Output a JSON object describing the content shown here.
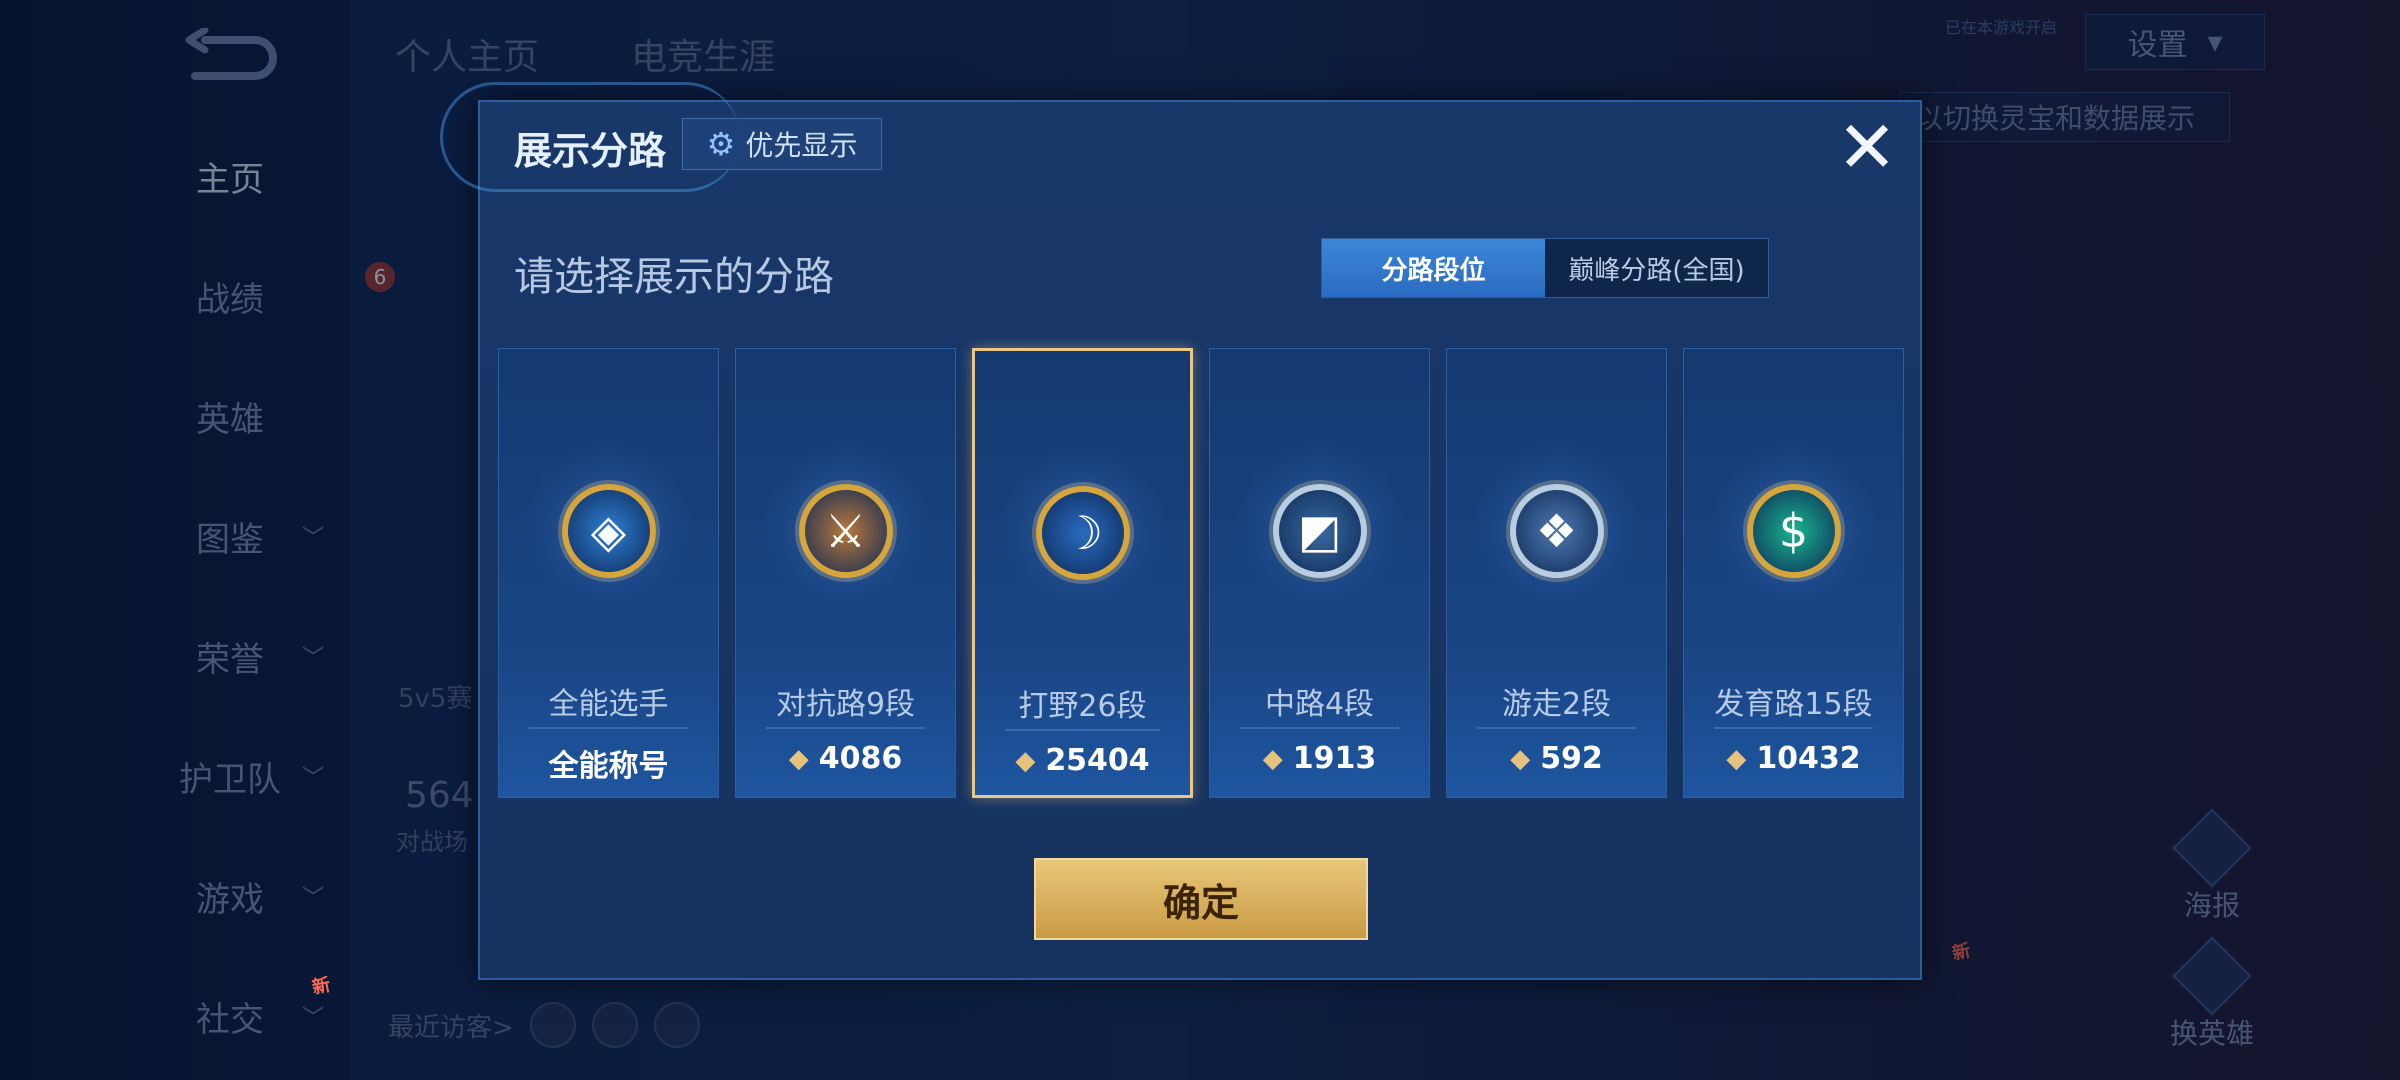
{
  "sidebar": {
    "items": [
      {
        "label": "主页",
        "has_chevron": false
      },
      {
        "label": "战绩",
        "has_chevron": false
      },
      {
        "label": "英雄",
        "has_chevron": false
      },
      {
        "label": "图鉴",
        "has_chevron": true
      },
      {
        "label": "荣誉",
        "has_chevron": true
      },
      {
        "label": "护卫队",
        "has_chevron": true
      },
      {
        "label": "游戏",
        "has_chevron": true
      },
      {
        "label": "社交",
        "has_chevron": true
      }
    ],
    "new_badge": "新"
  },
  "top_tabs": [
    "个人主页",
    "电竞生涯"
  ],
  "settings": {
    "label": "设置",
    "small_badge": "已在本游戏开启"
  },
  "hint_strip": "以切换灵宝和数据展示",
  "background": {
    "level_badge": "6",
    "stat_text_1": "5v5赛",
    "stat_value": "564",
    "stat_text_2": "对战场",
    "visitors_label": "最近访客>"
  },
  "side_tools": [
    {
      "label": "海报",
      "icon": "poster-icon"
    },
    {
      "label": "换英雄",
      "icon": "swap-hero-icon",
      "badge": "新"
    }
  ],
  "dialog": {
    "title": "展示分路",
    "priority_label": "优先显示",
    "close_symbol": "✕",
    "subtitle": "请选择展示的分路",
    "tabs": [
      {
        "label": "分路段位",
        "active": true
      },
      {
        "label": "巅峰分路(全国)",
        "active": false
      }
    ],
    "lanes": [
      {
        "name": "全能选手",
        "score": "全能称号",
        "icon": "all-round-emblem",
        "symbol": "◈",
        "selected": false,
        "metal": "gold",
        "color": "#2f7fd4"
      },
      {
        "name": "对抗路9段",
        "score": "4086",
        "icon": "clash-lane-emblem",
        "symbol": "⚔",
        "selected": false,
        "metal": "gold",
        "color": "#b9783a"
      },
      {
        "name": "打野26段",
        "score": "25404",
        "icon": "jungle-emblem",
        "symbol": "☽",
        "selected": true,
        "metal": "gold",
        "color": "#2a6cc0"
      },
      {
        "name": "中路4段",
        "score": "1913",
        "icon": "mid-lane-emblem",
        "symbol": "◩",
        "selected": false,
        "metal": "silver",
        "color": "#3a6aa0"
      },
      {
        "name": "游走2段",
        "score": "592",
        "icon": "roam-emblem",
        "symbol": "❖",
        "selected": false,
        "metal": "silver",
        "color": "#4f7ab0"
      },
      {
        "name": "发育路15段",
        "score": "10432",
        "icon": "farm-lane-emblem",
        "symbol": "$",
        "selected": false,
        "metal": "gold",
        "color": "#19b58e"
      }
    ],
    "confirm_label": "确定"
  }
}
